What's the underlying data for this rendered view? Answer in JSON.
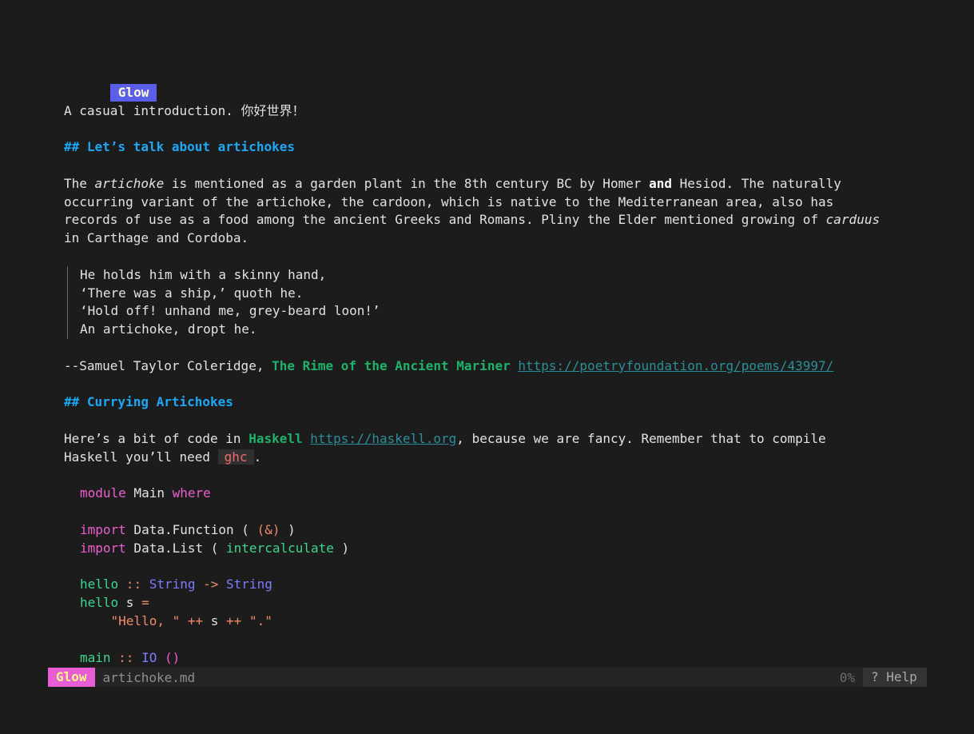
{
  "document": {
    "title_badge": "Glow",
    "intro": "A casual introduction. 你好世界！",
    "section1": {
      "heading": "## Let’s talk about artichokes",
      "para": [
        {
          "pre": "The ",
          "em": "artichoke",
          "mid": " is mentioned as a garden plant in the 8th century BC by Homer ",
          "strong": "and",
          "post": " Hesiod. The naturally"
        },
        "occurring variant of the artichoke, the cardoon, which is native to the Mediterranean area, also has",
        {
          "pre": "records of use as a food among the ancient Greeks and Romans. Pliny the Elder mentioned growing of ",
          "em": "carduus"
        },
        "in Carthage and Cordoba."
      ]
    },
    "quote": [
      "He holds him with a skinny hand,",
      "‘There was a ship,’ quoth he.",
      "‘Hold off! unhand me, grey-beard loon!’",
      "An artichoke, dropt he."
    ],
    "attribution": {
      "pre": "--Samuel Taylor Coleridge, ",
      "title": "The Rime of the Ancient Mariner",
      "link": "https://poetryfoundation.org/poems/43997/"
    },
    "section2": {
      "heading": "## Currying Artichokes",
      "line1": {
        "pre": "Here’s a bit of code in ",
        "strong": "Haskell",
        "link": "https://haskell.org",
        "post": ", because we are fancy. Remember that to compile"
      },
      "line2": {
        "pre": "Haskell you’ll need ",
        "code": "ghc",
        "post": "."
      }
    },
    "code": {
      "l1": {
        "kw": "module",
        "mid": " Main ",
        "kw2": "where"
      },
      "l2": {
        "kw": "import",
        "mid": " Data.Function ( ",
        "op": "(&)",
        "post": " )"
      },
      "l3": {
        "kw": "import",
        "mid": " Data.List ( ",
        "fn": "intercalculate",
        "post": " )"
      },
      "l4": {
        "fn": "hello",
        "op1": " :: ",
        "ty1": "String",
        "op2": " -> ",
        "ty2": "String"
      },
      "l5": {
        "fn": "hello",
        "mid": " s ",
        "op": "="
      },
      "l6": {
        "indent": "    ",
        "s1": "\"Hello, \"",
        "op1": " ++ ",
        "mid": "s",
        "op2": " ++ ",
        "s2": "\".\""
      },
      "l7": {
        "fn": "main",
        "op": " :: ",
        "ty": "IO",
        "post": " ()"
      }
    }
  },
  "statusbar": {
    "badge": "Glow",
    "filename": "artichoke.md",
    "percent": "0%",
    "help": "? Help"
  }
}
